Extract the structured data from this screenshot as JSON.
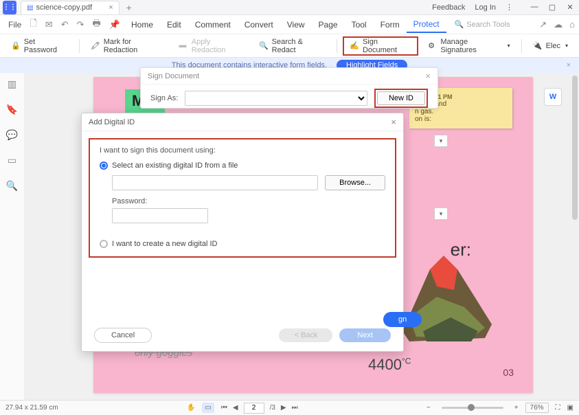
{
  "titlebar": {
    "tab_name": "science-copy.pdf",
    "feedback": "Feedback",
    "login": "Log In"
  },
  "menu": {
    "file": "File",
    "items": [
      "Home",
      "Edit",
      "Comment",
      "Convert",
      "View",
      "Page",
      "Tool",
      "Form",
      "Protect"
    ],
    "active": "Protect",
    "search_tools": "Search Tools"
  },
  "toolbar": {
    "set_password": "Set Password",
    "mark_redaction": "Mark for Redaction",
    "apply_redaction": "Apply Redaction",
    "search_redact": "Search & Redact",
    "sign_document": "Sign Document",
    "manage_signatures": "Manage Signatures",
    "elec": "Elec"
  },
  "infobar": {
    "msg": "This document contains interactive form fields.",
    "btn": "Highlight Fields"
  },
  "sign_dialog": {
    "title": "Sign Document",
    "sign_as": "Sign As:",
    "new_id": "New ID"
  },
  "add_id_dialog": {
    "title": "Add Digital ID",
    "prompt": "I want to sign this document using:",
    "opt_existing": "Select an existing digital ID from a file",
    "browse": "Browse...",
    "password_label": "Password:",
    "opt_new": "I want to create a new digital ID",
    "cancel": "Cancel",
    "back": "< Back",
    "next": "Next"
  },
  "doc": {
    "title_partial": "Mat",
    "sticky_head": "Mon 4:11 PM",
    "sticky_body": "stable and\nn gas.\non is:",
    "answer": "er:",
    "temperature": "4400",
    "temp_unit": "°C",
    "page_num": "03",
    "goggles": "only goggles",
    "word_badge": "W"
  },
  "peek": {
    "sign": "gn"
  },
  "status": {
    "dims": "27.94 x 21.59 cm",
    "page_current": "2",
    "page_total": "/3",
    "zoom": "76%"
  }
}
